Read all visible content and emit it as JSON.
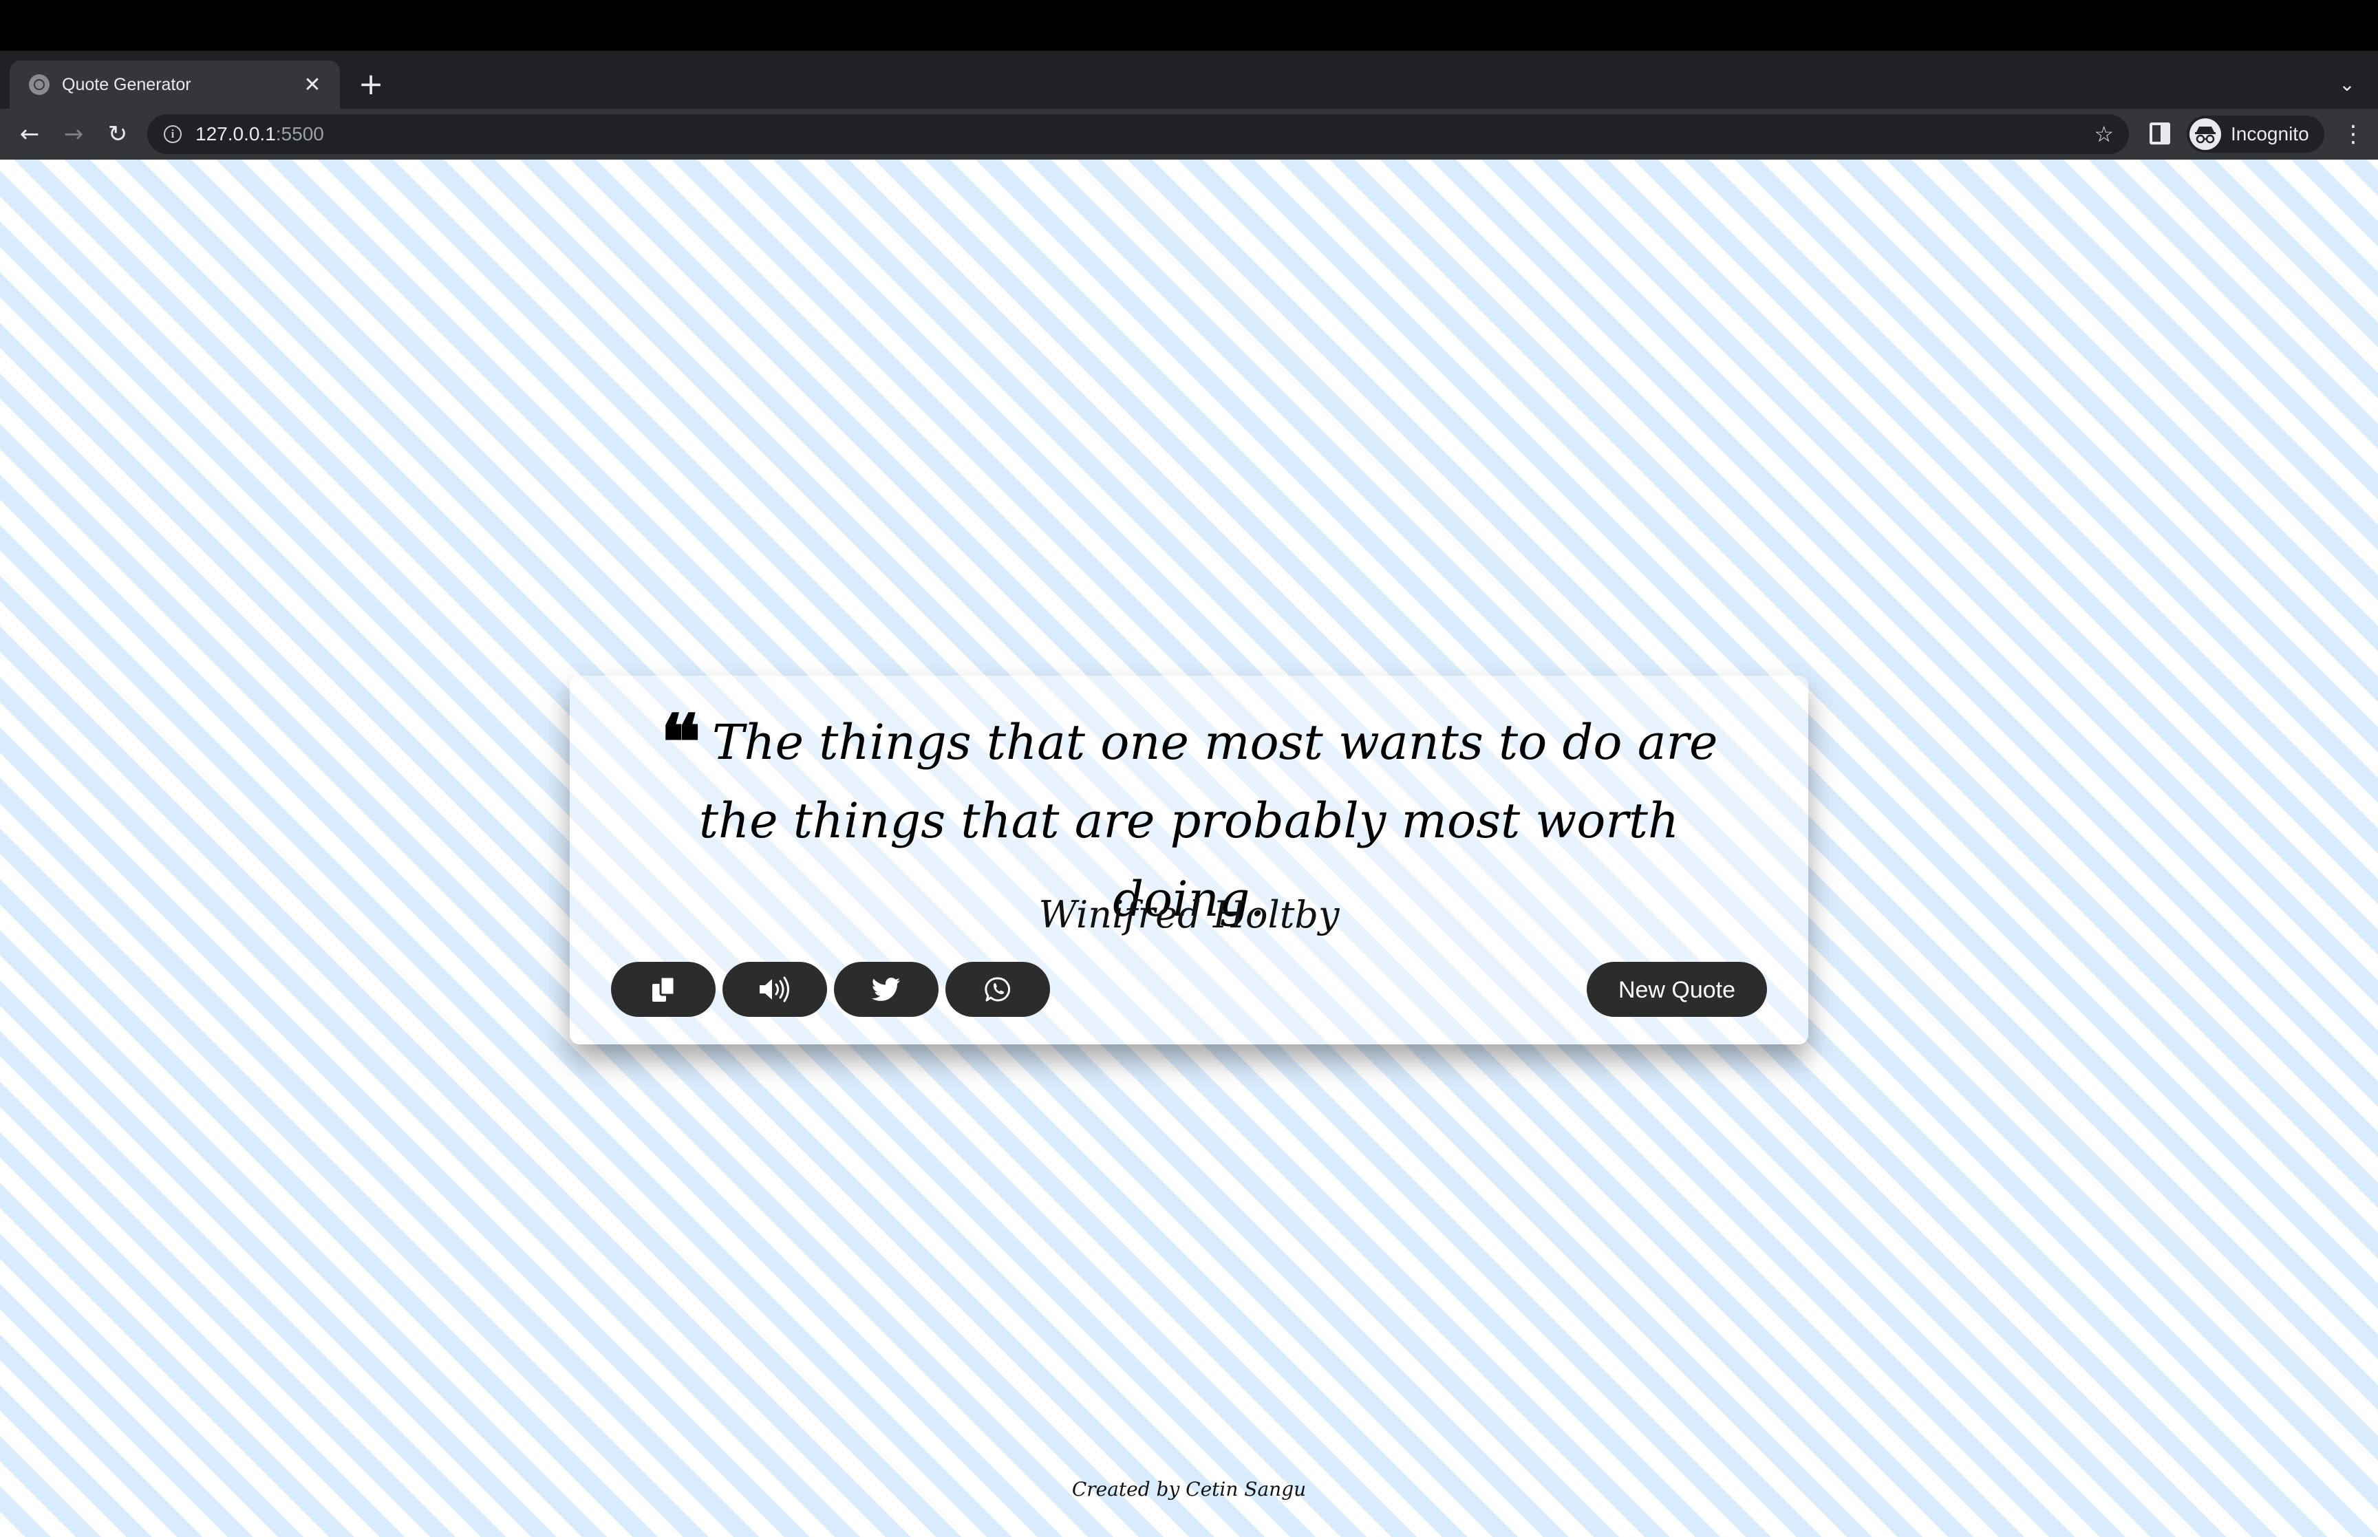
{
  "browser": {
    "tab_title": "Quote Generator",
    "tab_close_glyph": "✕",
    "new_tab_glyph": "+",
    "tab_menu_glyph": "⌄",
    "back_glyph": "←",
    "forward_glyph": "→",
    "reload_glyph": "↻",
    "url_host": "127.0.0.1",
    "url_port": ":5500",
    "info_glyph": "i",
    "bookmark_glyph": "☆",
    "profile_label": "Incognito",
    "menu_glyph": "⋮"
  },
  "quote_card": {
    "quote_mark": "❝",
    "quote_text": "The things that one most wants to do are the things that are probably most worth doing.",
    "author": "Winifred Holtby",
    "new_quote_label": "New Quote",
    "icons": [
      "copy-icon",
      "speaker-icon",
      "twitter-icon",
      "whatsapp-icon"
    ]
  },
  "footer": {
    "credit": "Created by Cetin Sangu"
  },
  "colors": {
    "stripe_light": "#ffffff",
    "stripe_blue": "#d9ecfd",
    "button_dark": "#2c2c2c",
    "chrome_dark": "#202124",
    "chrome_toolbar": "#35363a"
  }
}
